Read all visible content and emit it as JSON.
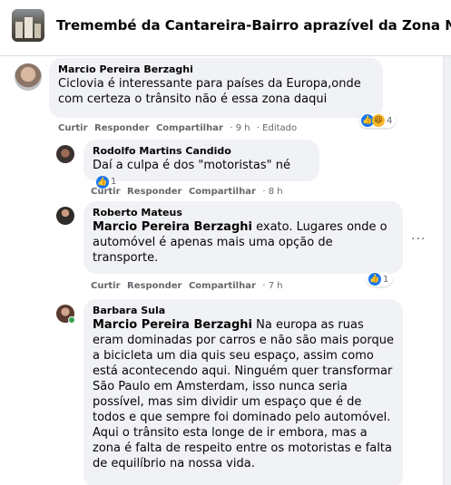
{
  "header": {
    "group_title": "Tremembé da Cantareira-Bairro aprazível da Zona Norte de SP"
  },
  "actions": {
    "like": "Curtir",
    "reply": "Responder",
    "share": "Compartilhar"
  },
  "comments": [
    {
      "author": "Marcio Pereira Berzaghi",
      "text": "Ciclovia é interessante para países da Europa,onde com certeza o trânsito não é essa zona daqui",
      "time": "9 h",
      "edited": "Editado",
      "reaction_count": "4",
      "reaction_icons": [
        "like-icon",
        "haha-icon"
      ]
    },
    {
      "author": "Rodolfo Martins Candido",
      "text": "Daí a culpa é dos \"motoristas\" né",
      "time": "8 h",
      "reaction_count": "1",
      "reaction_icons": [
        "like-icon"
      ]
    },
    {
      "author": "Roberto Mateus",
      "mention": "Marcio Pereira Berzaghi",
      "text": " exato. Lugares onde o automóvel é apenas mais uma opção de transporte.",
      "time": "7 h",
      "reaction_count": "1",
      "reaction_icons": [
        "like-icon"
      ]
    },
    {
      "author": "Barbara Sula",
      "mention": "Marcio Pereira Berzaghi",
      "text": " Na europa as ruas eram dominadas por carros e não são mais porque a bicicleta um dia quis seu espaço, assim como está acontecendo aqui. Ninguém quer transformar São Paulo em Amsterdam, isso nunca seria possível, mas sim dividir um espaço que é de todos e que sempre foi dominado pelo automóvel.",
      "text2": "Aqui o trânsito esta longe de ir embora, mas a zona é falta de respeito entre os motoristas e falta de equilíbrio na nossa vida."
    }
  ],
  "colors": {
    "bubble": "#f0f2f5",
    "like": "#1877f2",
    "haha": "#f7b928",
    "online": "#31a24c"
  }
}
